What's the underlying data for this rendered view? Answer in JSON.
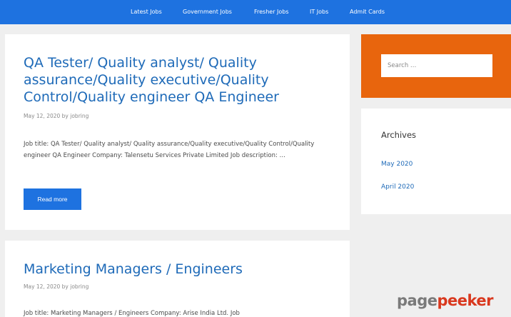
{
  "nav": {
    "items": [
      {
        "label": "Latest Jobs"
      },
      {
        "label": "Government Jobs"
      },
      {
        "label": "Fresher Jobs"
      },
      {
        "label": "IT Jobs"
      },
      {
        "label": "Admit Cards"
      }
    ]
  },
  "posts": [
    {
      "title": "QA Tester/ Quality analyst/ Quality assurance/Quality executive/Quality Control/Quality engineer QA Engineer",
      "meta": "May 12, 2020 by jobring",
      "excerpt": "Job title: QA Tester/ Quality analyst/ Quality assurance/Quality executive/Quality Control/Quality engineer QA Engineer Company: Talensetu Services Private Limited Job description: …",
      "read_more": "Read more"
    },
    {
      "title": "Marketing Managers / Engineers",
      "meta": "May 12, 2020 by jobring",
      "excerpt": "Job title: Marketing Managers / Engineers Company: Arise India Ltd. Job"
    }
  ],
  "sidebar": {
    "search_placeholder": "Search …",
    "archives_title": "Archives",
    "archives": [
      {
        "label": "May 2020"
      },
      {
        "label": "April 2020"
      }
    ]
  },
  "watermark": {
    "part1": "page",
    "part2": "peeker"
  },
  "colors": {
    "nav_bg": "#1e72e0",
    "link": "#1e6ab8",
    "search_bg": "#e8650d",
    "button": "#1e72e0"
  }
}
